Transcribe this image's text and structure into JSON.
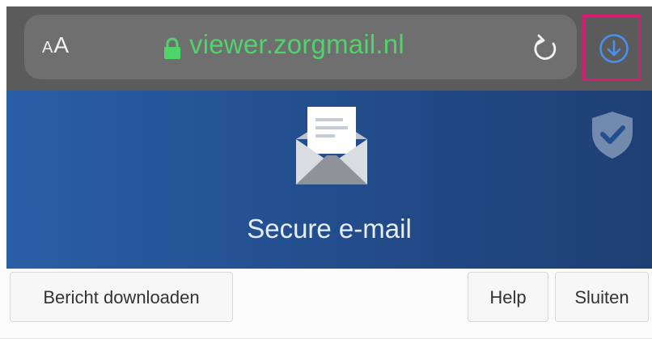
{
  "browser": {
    "text_size_label": "AA",
    "url": "viewer.zorgmail.nl",
    "url_color": "#4fd36b",
    "highlight_color": "#d81a73",
    "download_icon_color": "#4a8ff0"
  },
  "banner": {
    "title": "Secure e-mail",
    "gradient_start": "#2a5ea6",
    "gradient_end": "#1e3f74"
  },
  "actions": {
    "download_label": "Bericht downloaden",
    "help_label": "Help",
    "close_label": "Sluiten"
  }
}
